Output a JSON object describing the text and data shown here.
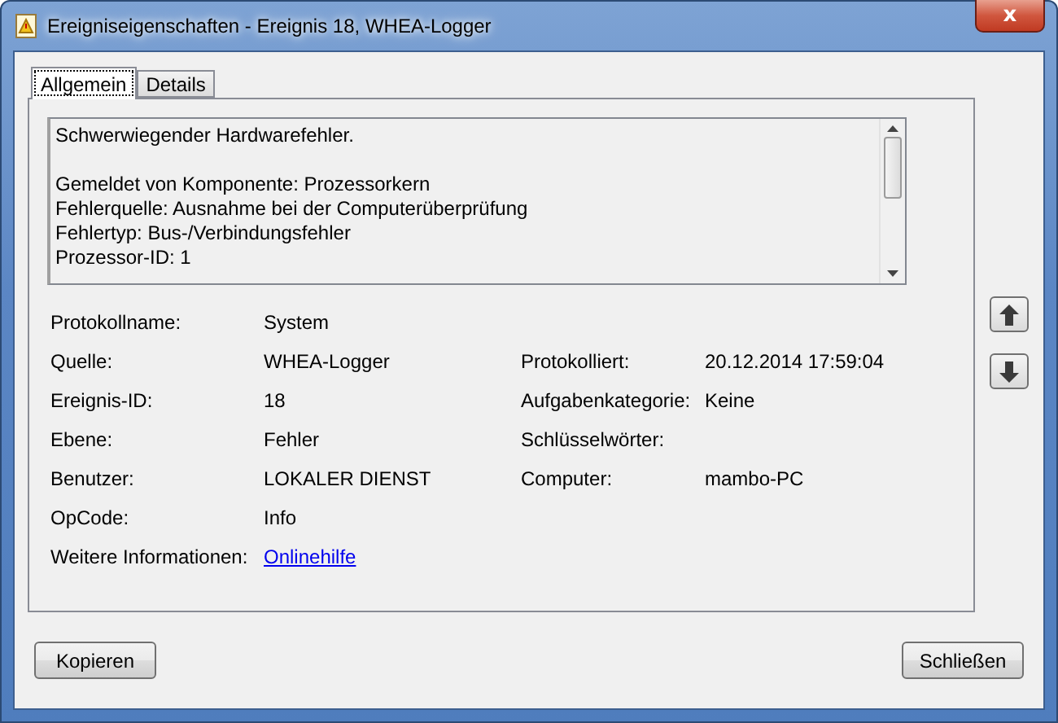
{
  "window": {
    "title": "Ereigniseigenschaften - Ereignis 18, WHEA-Logger",
    "close_label": "x"
  },
  "tabs": [
    {
      "label": "Allgemein",
      "selected": true
    },
    {
      "label": "Details",
      "selected": false
    }
  ],
  "description": {
    "paragraphs": [
      [
        "Schwerwiegender Hardwarefehler."
      ],
      [
        "Gemeldet von Komponente: Prozessorkern",
        "Fehlerquelle: Ausnahme bei der Computerüberprüfung",
        "Fehlertyp: Bus-/Verbindungsfehler",
        "Prozessor-ID: 1"
      ]
    ]
  },
  "rows": [
    {
      "left": {
        "label": "Protokollname:",
        "value": "System",
        "kind": "text"
      }
    },
    {
      "left": {
        "label": "Quelle:",
        "value": "WHEA-Logger",
        "kind": "text"
      },
      "right": {
        "label": "Protokolliert:",
        "value": "20.12.2014 17:59:04"
      }
    },
    {
      "left": {
        "label": "Ereignis-ID:",
        "value": "18",
        "kind": "text"
      },
      "right": {
        "label": "Aufgabenkategorie:",
        "value": "Keine"
      }
    },
    {
      "left": {
        "label": "Ebene:",
        "value": "Fehler",
        "kind": "text"
      },
      "right": {
        "label": "Schlüsselwörter:"
      }
    },
    {
      "left": {
        "label": "Benutzer:",
        "value": "LOKALER DIENST",
        "kind": "text"
      },
      "right": {
        "label": "Computer:",
        "value": "mambo-PC"
      }
    },
    {
      "left": {
        "label": "OpCode:",
        "value": "Info",
        "kind": "text"
      }
    },
    {
      "left": {
        "label": "Weitere Informationen:",
        "value": "Onlinehilfe",
        "kind": "link"
      }
    }
  ],
  "buttons": {
    "copy": "Kopieren",
    "close": "Schließen"
  }
}
